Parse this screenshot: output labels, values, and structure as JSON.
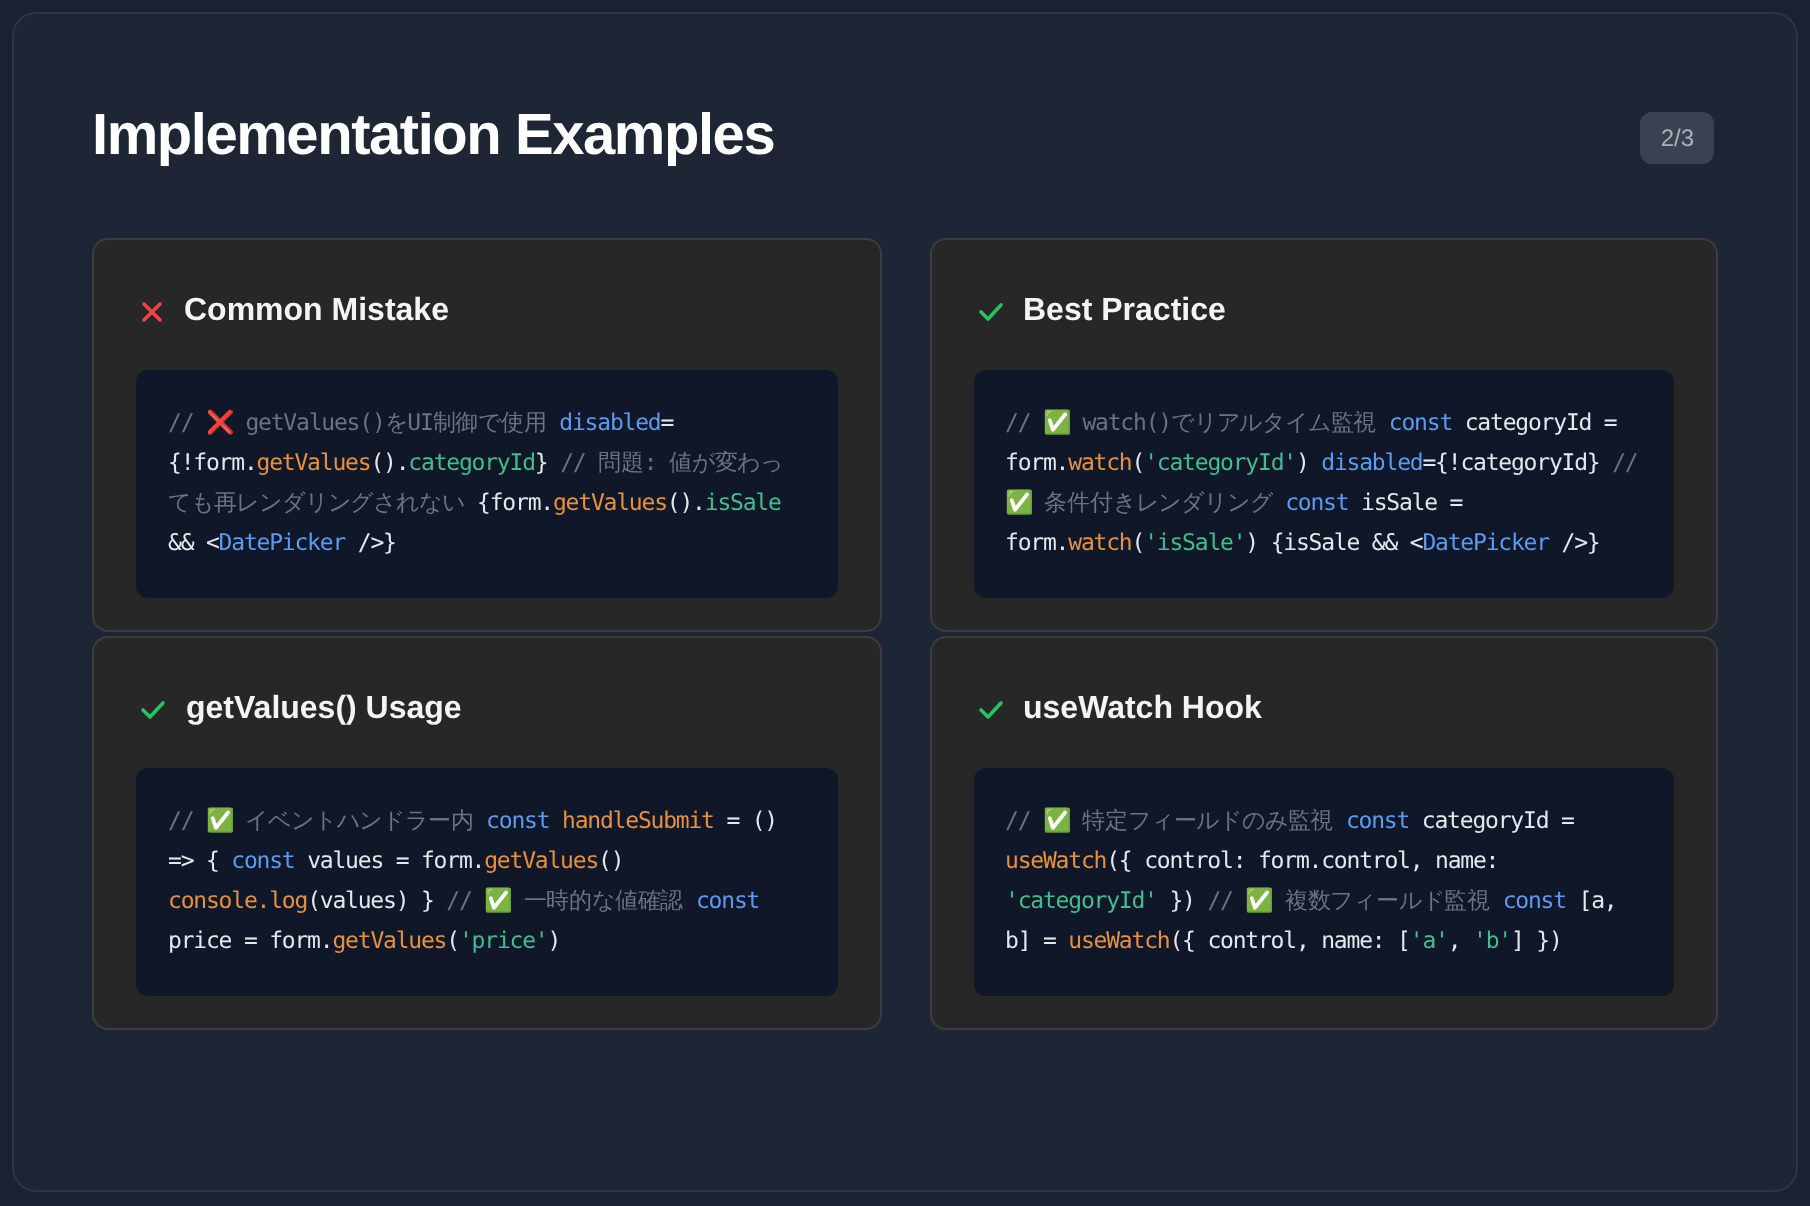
{
  "title": "Implementation Examples",
  "page_badge": "2/3",
  "cards": [
    {
      "kind": "bad",
      "title": "Common Mistake",
      "code": [
        {
          "kind": "comment",
          "text": "// "
        },
        {
          "kind": "emoji",
          "text": "❌"
        },
        {
          "kind": "comment",
          "text": " getValues()をUI制御で使用 "
        },
        {
          "kind": "keyword",
          "text": "disabled"
        },
        {
          "kind": "plain",
          "text": "= {!form."
        },
        {
          "kind": "func",
          "text": "getValues"
        },
        {
          "kind": "plain",
          "text": "()."
        },
        {
          "kind": "prop",
          "text": "categoryId"
        },
        {
          "kind": "plain",
          "text": "} "
        },
        {
          "kind": "comment",
          "text": "// 問題: 値が変わっても再レンダリングされない "
        },
        {
          "kind": "plain",
          "text": "{form."
        },
        {
          "kind": "func",
          "text": "getValues"
        },
        {
          "kind": "plain",
          "text": "()."
        },
        {
          "kind": "prop",
          "text": "isSale"
        },
        {
          "kind": "plain",
          "text": " && <"
        },
        {
          "kind": "keyword",
          "text": "DatePicker"
        },
        {
          "kind": "plain",
          "text": " />}"
        }
      ]
    },
    {
      "kind": "good",
      "title": "Best Practice",
      "code": [
        {
          "kind": "comment",
          "text": "// "
        },
        {
          "kind": "emoji",
          "text": "✅"
        },
        {
          "kind": "comment",
          "text": " watch()でリアルタイム監視 "
        },
        {
          "kind": "keyword",
          "text": "const"
        },
        {
          "kind": "plain",
          "text": " categoryId = form."
        },
        {
          "kind": "func",
          "text": "watch"
        },
        {
          "kind": "plain",
          "text": "("
        },
        {
          "kind": "prop",
          "text": "'categoryId'"
        },
        {
          "kind": "plain",
          "text": ") "
        },
        {
          "kind": "keyword",
          "text": "disabled"
        },
        {
          "kind": "plain",
          "text": "={!categoryId} "
        },
        {
          "kind": "comment",
          "text": "// "
        },
        {
          "kind": "emoji",
          "text": "✅"
        },
        {
          "kind": "comment",
          "text": " 条件付きレンダリング "
        },
        {
          "kind": "keyword",
          "text": "const"
        },
        {
          "kind": "plain",
          "text": " isSale = form."
        },
        {
          "kind": "func",
          "text": "watch"
        },
        {
          "kind": "plain",
          "text": "("
        },
        {
          "kind": "prop",
          "text": "'isSale'"
        },
        {
          "kind": "plain",
          "text": ") {isSale && <"
        },
        {
          "kind": "keyword",
          "text": "DatePicker"
        },
        {
          "kind": "plain",
          "text": " />}"
        }
      ]
    },
    {
      "kind": "good",
      "title": "getValues() Usage",
      "code": [
        {
          "kind": "comment",
          "text": "// "
        },
        {
          "kind": "emoji",
          "text": "✅"
        },
        {
          "kind": "comment",
          "text": " イベントハンドラー内 "
        },
        {
          "kind": "keyword",
          "text": "const "
        },
        {
          "kind": "func",
          "text": "handleSubmit"
        },
        {
          "kind": "plain",
          "text": " = () => { "
        },
        {
          "kind": "keyword",
          "text": "const"
        },
        {
          "kind": "plain",
          "text": " values = form."
        },
        {
          "kind": "func",
          "text": "getValues"
        },
        {
          "kind": "plain",
          "text": "() "
        },
        {
          "kind": "func",
          "text": "console.log"
        },
        {
          "kind": "plain",
          "text": "(values) } "
        },
        {
          "kind": "comment",
          "text": "// "
        },
        {
          "kind": "emoji",
          "text": "✅"
        },
        {
          "kind": "comment",
          "text": " 一時的な値確認 "
        },
        {
          "kind": "keyword",
          "text": "const"
        },
        {
          "kind": "plain",
          "text": " price = form."
        },
        {
          "kind": "func",
          "text": "getValues"
        },
        {
          "kind": "plain",
          "text": "("
        },
        {
          "kind": "prop",
          "text": "'price'"
        },
        {
          "kind": "plain",
          "text": ")"
        }
      ]
    },
    {
      "kind": "good",
      "title": "useWatch Hook",
      "code": [
        {
          "kind": "comment",
          "text": "// "
        },
        {
          "kind": "emoji",
          "text": "✅"
        },
        {
          "kind": "comment",
          "text": " 特定フィールドのみ監視 "
        },
        {
          "kind": "keyword",
          "text": "const"
        },
        {
          "kind": "plain",
          "text": " categoryId = "
        },
        {
          "kind": "func",
          "text": "useWatch"
        },
        {
          "kind": "plain",
          "text": "({ control: form.control, name: "
        },
        {
          "kind": "prop",
          "text": "'categoryId'"
        },
        {
          "kind": "plain",
          "text": " }) "
        },
        {
          "kind": "comment",
          "text": "// "
        },
        {
          "kind": "emoji",
          "text": "✅"
        },
        {
          "kind": "comment",
          "text": " 複数フィールド監視 "
        },
        {
          "kind": "keyword",
          "text": "const"
        },
        {
          "kind": "plain",
          "text": " [a, b] = "
        },
        {
          "kind": "func",
          "text": "useWatch"
        },
        {
          "kind": "plain",
          "text": "({ control, name: ["
        },
        {
          "kind": "prop",
          "text": "'a'"
        },
        {
          "kind": "plain",
          "text": ", "
        },
        {
          "kind": "prop",
          "text": "'b'"
        },
        {
          "kind": "plain",
          "text": "] })"
        }
      ]
    }
  ]
}
